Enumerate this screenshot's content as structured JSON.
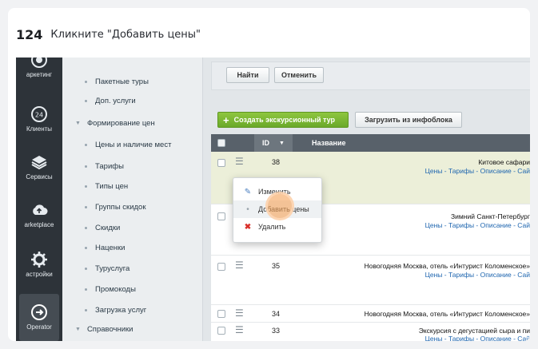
{
  "step": {
    "number": "124",
    "instruction": "Кликните \"Добавить цены\""
  },
  "rail": {
    "items": [
      {
        "label": "аркетинг",
        "icon": "target-icon"
      },
      {
        "label": "Клиенты",
        "icon": "clients-icon"
      },
      {
        "label": "Сервисы",
        "icon": "layers-icon"
      },
      {
        "label": "arketplace",
        "icon": "cloud-upload-icon"
      },
      {
        "label": "астройки",
        "icon": "gear-icon"
      },
      {
        "label": "Operator",
        "icon": "arrow-circle-icon"
      }
    ]
  },
  "sidebar": {
    "items": [
      {
        "label": "Пакетные туры",
        "level": 2
      },
      {
        "label": "Доп. услуги",
        "level": 2
      },
      {
        "label": "Формирование цен",
        "level": 1
      },
      {
        "label": "Цены и наличие мест",
        "level": 2
      },
      {
        "label": "Тарифы",
        "level": 2
      },
      {
        "label": "Типы цен",
        "level": 2
      },
      {
        "label": "Группы скидок",
        "level": 2
      },
      {
        "label": "Скидки",
        "level": 2
      },
      {
        "label": "Наценки",
        "level": 2
      },
      {
        "label": "Туруслуга",
        "level": 2
      },
      {
        "label": "Промокоды",
        "level": 2
      },
      {
        "label": "Загрузка услуг",
        "level": 2
      },
      {
        "label": "Справочники",
        "level": 1
      }
    ]
  },
  "filter": {
    "find_label": "Найти",
    "cancel_label": "Отменить"
  },
  "toolbar": {
    "add_label": "Создать экскурсионный тур",
    "load_label": "Загрузить из инфоблока"
  },
  "grid": {
    "columns": {
      "id": "ID",
      "name": "Название"
    },
    "rows": [
      {
        "id": "38",
        "name": "Китовое сафари",
        "links": "Цены - Тарифы - Описание - Сай"
      },
      {
        "id": "",
        "name": "Зимний Санкт-Петербург",
        "links": "Цены - Тарифы - Описание - Сай"
      },
      {
        "id": "35",
        "name": "Новогодняя Москва, отель «Интурист Коломенское»",
        "links": "Цены - Тарифы - Описание - Сай"
      },
      {
        "id": "34",
        "name": "Новогодняя Москва, отель «Интурист Коломенское»",
        "links": ""
      },
      {
        "id": "33",
        "name": "Экскурсия с дегустацией сыра и пи",
        "links": "Цены - Тарифы - Описание - Сай"
      }
    ]
  },
  "context_menu": {
    "items": [
      {
        "label": "Изменить",
        "icon": "edit-icon"
      },
      {
        "label": "Добавить цены",
        "icon": "bullet-icon"
      },
      {
        "label": "Удалить",
        "icon": "delete-icon"
      }
    ]
  },
  "colors": {
    "add_button": "#7ab635",
    "link": "#2067b0",
    "grid_header": "#58616a",
    "click_marker": "#f6a45c"
  }
}
